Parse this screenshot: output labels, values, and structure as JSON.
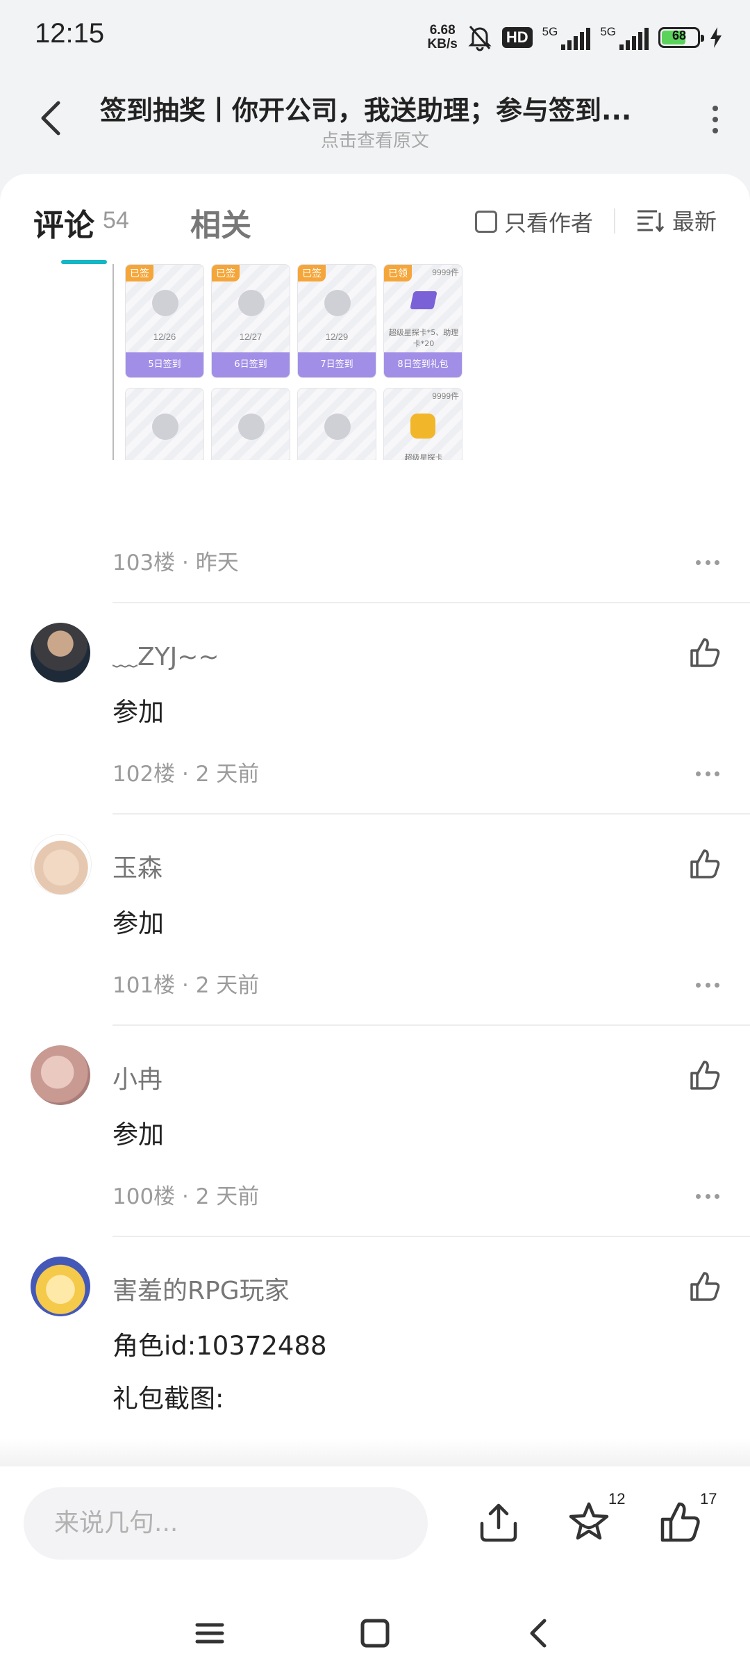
{
  "status_bar": {
    "time": "12:15",
    "net_speed_value": "6.68",
    "net_speed_unit": "KB/s",
    "hd_label": "HD",
    "sim1_label": "5G",
    "sim2_label": "5G",
    "battery_level": "68"
  },
  "header": {
    "title": "签到抽奖丨你开公司，我送助理；参与签到...",
    "subtitle": "点击查看原文"
  },
  "tabs": {
    "comments_label": "评论",
    "comments_count": "54",
    "related_label": "相关",
    "author_only_label": "只看作者",
    "sort_label": "最新"
  },
  "image_grid": {
    "cards_row1": [
      {
        "tag": "已签",
        "date": "12/26",
        "button": "5日签到"
      },
      {
        "tag": "已签",
        "date": "12/27",
        "button": "6日签到"
      },
      {
        "tag": "已签",
        "date": "12/29",
        "button": "7日签到"
      },
      {
        "tag": "已领",
        "qty": "9999件",
        "desc": "超级星探卡*5、助理卡*20",
        "button": "8日签到礼包"
      }
    ],
    "cards_row2": [
      {
        "qty": "",
        "desc": ""
      },
      {
        "qty": "",
        "desc": ""
      },
      {
        "qty": "",
        "desc": ""
      },
      {
        "qty": "9999件",
        "desc": "超级星探卡"
      }
    ]
  },
  "comments": [
    {
      "floor_meta": "103楼 · 昨天"
    },
    {
      "username": "﹏ZYJ~~",
      "text": "参加",
      "floor_meta": "102楼 · 2 天前"
    },
    {
      "username": "玉森",
      "text": "参加",
      "floor_meta": "101楼 · 2 天前"
    },
    {
      "username": "小冉",
      "text": "参加",
      "floor_meta": "100楼 · 2 天前"
    },
    {
      "username": "害羞的RPG玩家",
      "text": "角色id:10372488",
      "text2": "礼包截图:"
    }
  ],
  "bottom_bar": {
    "input_placeholder": "来说几句...",
    "favorite_count": "12",
    "like_count": "17"
  },
  "colors": {
    "accent": "#16b7c5",
    "card_bar": "#a18ee6",
    "tag": "#f5a63a"
  }
}
